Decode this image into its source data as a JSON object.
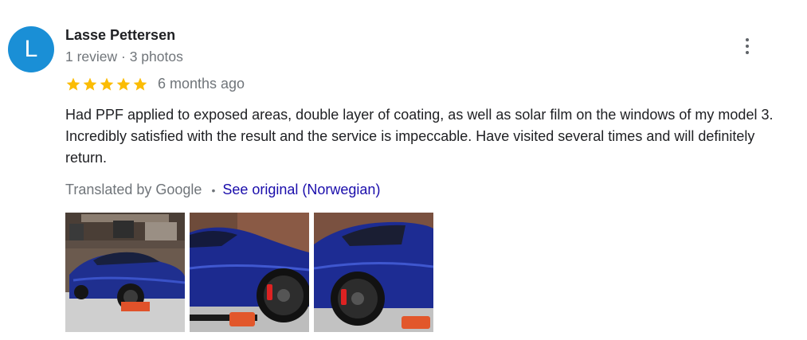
{
  "reviewer": {
    "initial": "L",
    "name": "Lasse Pettersen",
    "meta": "1 review · 3 photos",
    "avatar_color": "#1a8fd6"
  },
  "rating": {
    "stars": 5,
    "max": 5,
    "time": "6 months ago",
    "star_color": "#fbbc04"
  },
  "review_text": "Had PPF applied to exposed areas, double layer of coating, as well as solar film on the windows of my model 3. Incredibly satisfied with the result and the service is impeccable. Have visited several times and will definitely return.",
  "translation": {
    "label": "Translated by Google",
    "separator": "•",
    "link": "See original (Norwegian)",
    "link_color": "#1a0dab"
  },
  "photos": [
    {
      "icon": "car-photo-front"
    },
    {
      "icon": "car-photo-wheel-front"
    },
    {
      "icon": "car-photo-wheel-rear"
    }
  ],
  "menu_icon": "more-vert-icon"
}
